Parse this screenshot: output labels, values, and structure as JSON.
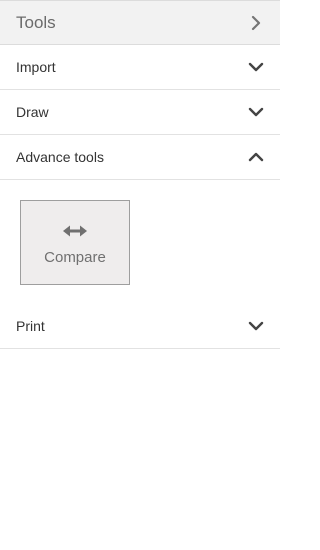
{
  "header": {
    "title": "Tools",
    "icon": "chevron-right-icon"
  },
  "sections": [
    {
      "label": "Import",
      "icon": "chevron-down-icon"
    },
    {
      "label": "Draw",
      "icon": "chevron-down-icon"
    },
    {
      "label": "Advance tools",
      "icon": "chevron-up-icon"
    },
    {
      "label": "Print",
      "icon": "chevron-down-icon"
    }
  ],
  "advance_tools": {
    "compare_label": "Compare",
    "compare_icon": "double-arrow-horizontal-icon"
  }
}
